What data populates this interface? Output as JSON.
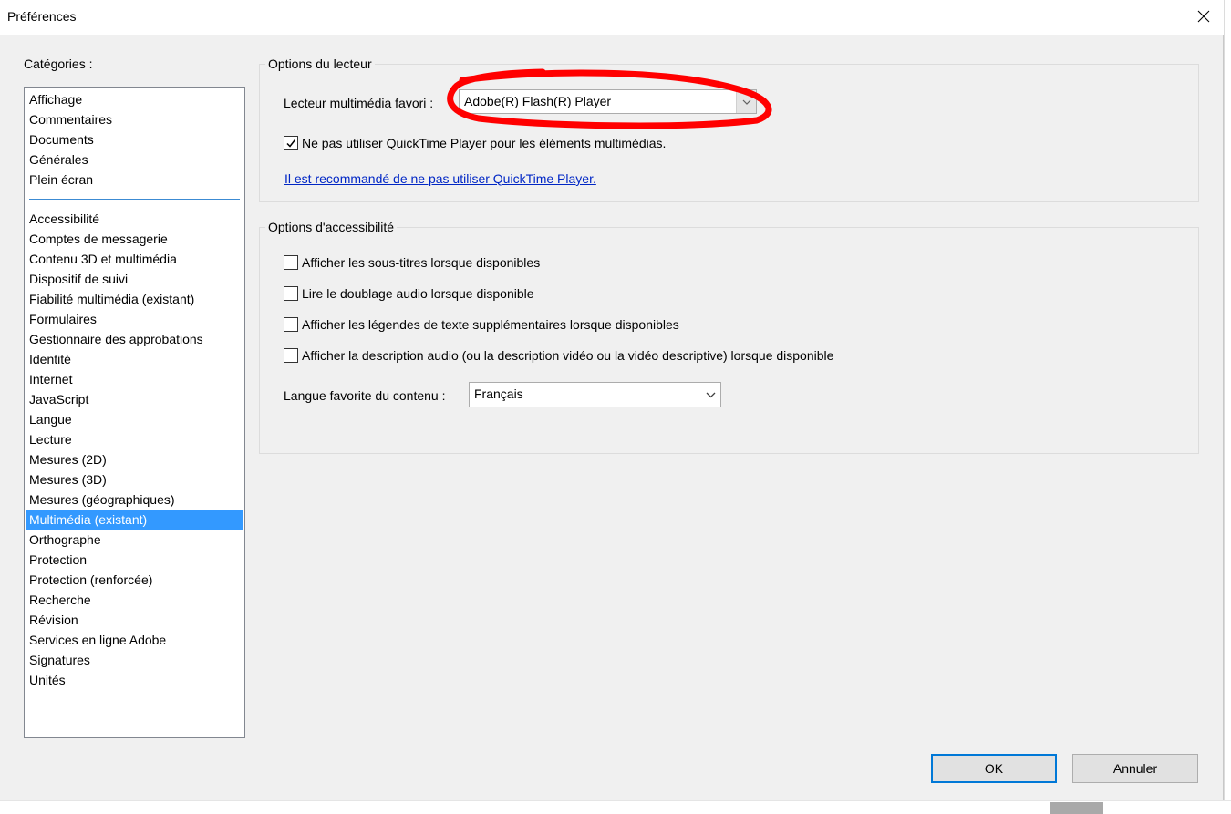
{
  "window": {
    "title": "Préférences"
  },
  "categories": {
    "label": "Catégories :",
    "group1": [
      "Affichage",
      "Commentaires",
      "Documents",
      "Générales",
      "Plein écran"
    ],
    "group2": [
      "Accessibilité",
      "Comptes de messagerie",
      "Contenu 3D et multimédia",
      "Dispositif de suivi",
      "Fiabilité multimédia (existant)",
      "Formulaires",
      "Gestionnaire des approbations",
      "Identité",
      "Internet",
      "JavaScript",
      "Langue",
      "Lecture",
      "Mesures (2D)",
      "Mesures (3D)",
      "Mesures (géographiques)",
      "Multimédia (existant)",
      "Orthographe",
      "Protection",
      "Protection (renforcée)",
      "Recherche",
      "Révision",
      "Services en ligne Adobe",
      "Signatures",
      "Unités"
    ],
    "selected": "Multimédia (existant)"
  },
  "player_options": {
    "legend": "Options du lecteur",
    "player_label": "Lecteur multimédia favori :",
    "player_value": "Adobe(R) Flash(R) Player",
    "quicktime_checkbox": "Ne pas utiliser QuickTime Player pour les éléments multimédias.",
    "quicktime_checked": true,
    "recommend_link": "Il est recommandé de ne pas utiliser QuickTime Player."
  },
  "accessibility_options": {
    "legend": "Options d'accessibilité",
    "checkboxes": [
      {
        "label": "Afficher les sous-titres lorsque disponibles",
        "checked": false
      },
      {
        "label": "Lire le doublage audio lorsque disponible",
        "checked": false
      },
      {
        "label": "Afficher les légendes de texte supplémentaires lorsque disponibles",
        "checked": false
      },
      {
        "label": "Afficher la description audio (ou la description vidéo ou la vidéo descriptive) lorsque disponible",
        "checked": false
      }
    ],
    "language_label": "Langue favorite du contenu :",
    "language_value": "Français"
  },
  "buttons": {
    "ok": "OK",
    "cancel": "Annuler"
  },
  "colors": {
    "selection": "#3399ff",
    "annotation": "#ff0000",
    "link": "#0026c5",
    "ok_border": "#0078d7"
  },
  "icons": {
    "close": "close-icon",
    "dropdown": "chevron-down-icon",
    "check": "check-icon"
  }
}
